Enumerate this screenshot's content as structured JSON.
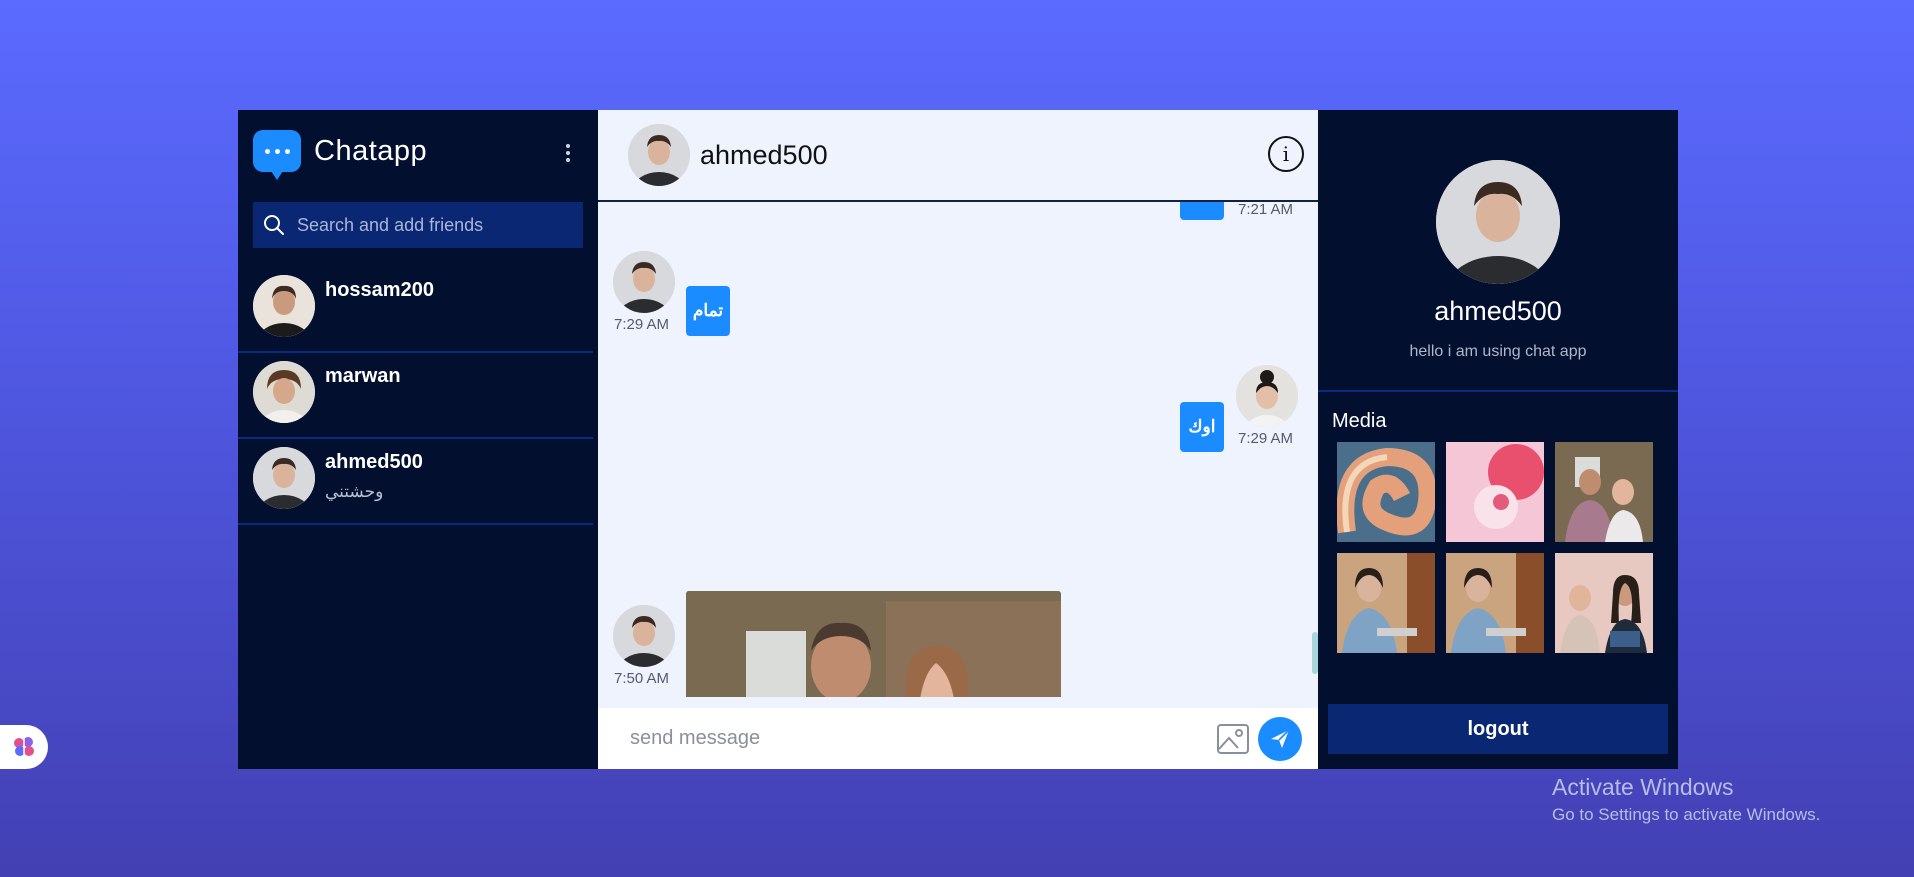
{
  "app": {
    "name": "Chatapp",
    "search_placeholder": "Search and add friends",
    "friends": [
      {
        "name": "hossam200",
        "last_message": ""
      },
      {
        "name": "marwan",
        "last_message": ""
      },
      {
        "name": "ahmed500",
        "last_message": "وحشتني"
      }
    ]
  },
  "chat": {
    "contact_name": "ahmed500",
    "messages": [
      {
        "side": "right",
        "text": "",
        "time": "7:21 AM"
      },
      {
        "side": "left",
        "text": "تمام",
        "time": "7:29 AM"
      },
      {
        "side": "right",
        "text": "اوك",
        "time": "7:29 AM"
      },
      {
        "side": "left",
        "type": "image",
        "time": "7:50 AM"
      }
    ],
    "composer_placeholder": "send message"
  },
  "profile": {
    "name": "ahmed500",
    "status": "hello i am using chat app",
    "media_title": "Media",
    "media_count": 6,
    "logout_label": "logout"
  },
  "watermark": {
    "line1": "Activate Windows",
    "line2": "Go to Settings to activate Windows."
  },
  "colors": {
    "accent": "#1a8cff",
    "panel_bg": "#020f2f",
    "chat_bg": "#eff3fe",
    "button_bg": "#0a2774"
  },
  "icons": [
    "chat-bubble-icon",
    "kebab-menu-icon",
    "search-icon",
    "info-icon",
    "image-icon",
    "send-icon",
    "brain-icon"
  ]
}
